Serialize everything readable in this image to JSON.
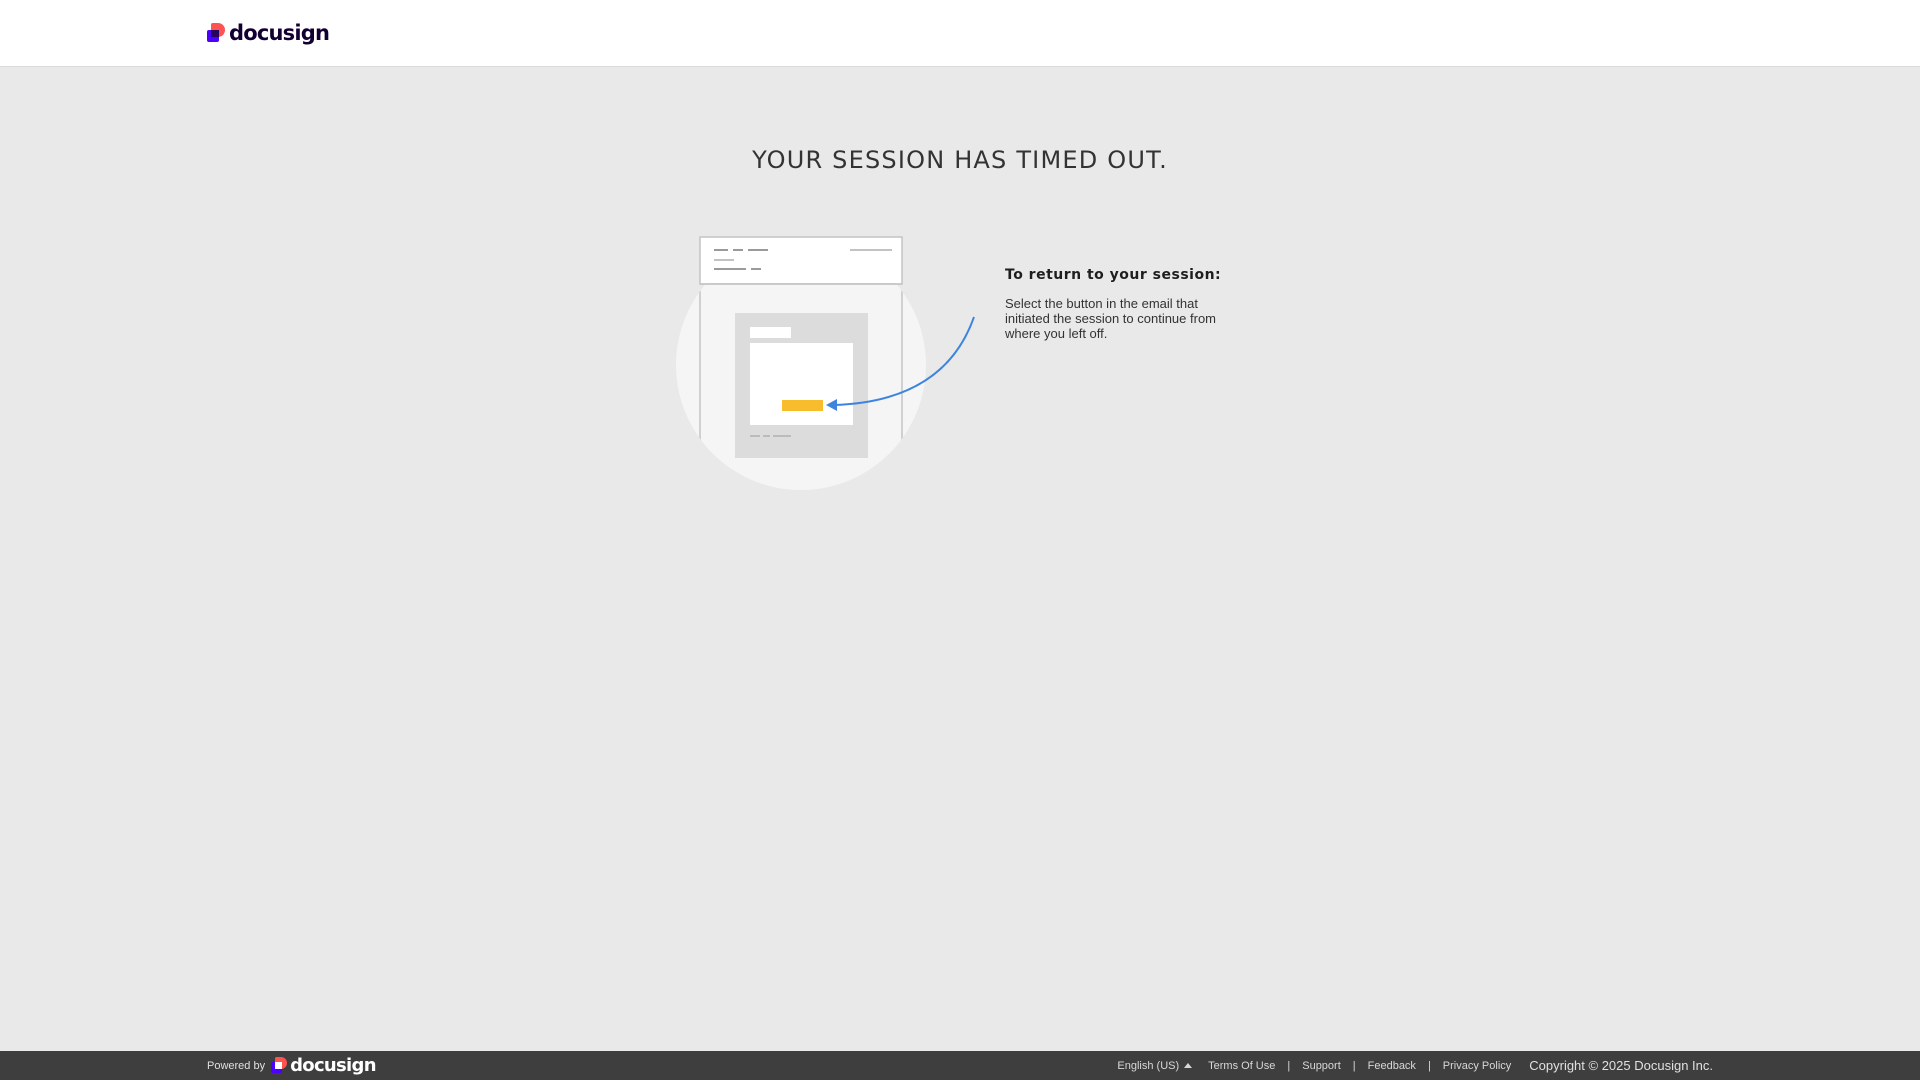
{
  "header": {
    "logo_text": "docusign"
  },
  "main": {
    "title": "YOUR SESSION HAS TIMED OUT.",
    "instructions_heading": "To return to your session:",
    "instructions_body": "Select the button in the email that initiated the session to continue from where you left off."
  },
  "footer": {
    "powered_by": "Powered by",
    "logo_text": "docusign",
    "language": "English (US)",
    "links": {
      "terms": "Terms Of Use",
      "support": "Support",
      "feedback": "Feedback",
      "privacy": "Privacy Policy"
    },
    "separator": "|",
    "copyright": "Copyright © 2025 Docusign Inc."
  },
  "colors": {
    "background": "#e9e9e9",
    "header_bg": "#ffffff",
    "footer_bg": "#3e3e3e",
    "brand_red": "#ff5252",
    "brand_purple": "#4c00ff",
    "button_yellow": "#f8bd2c",
    "arrow_blue": "#3d84e0"
  },
  "icons": {
    "logo": "docusign-logo-icon",
    "language_toggle": "caret-up-icon",
    "illustration": "email-button-illustration"
  }
}
